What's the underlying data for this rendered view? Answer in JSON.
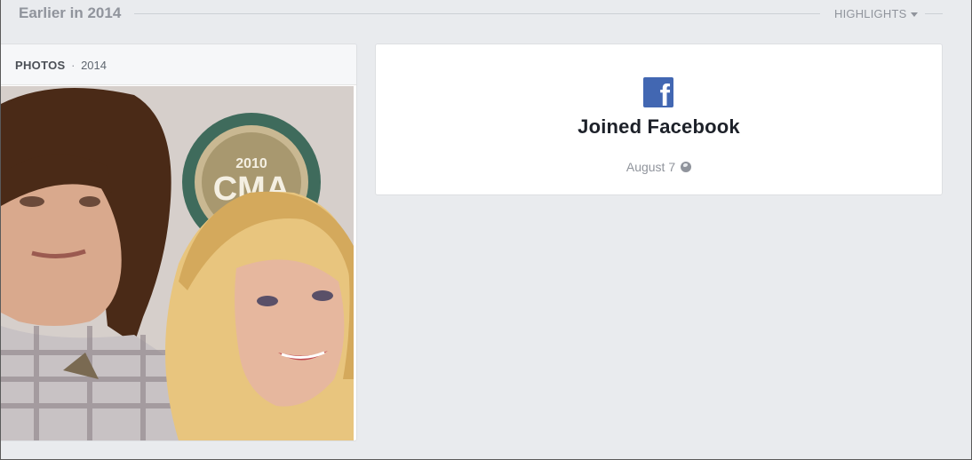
{
  "section": {
    "title": "Earlier in 2014",
    "highlights_label": "HIGHLIGHTS"
  },
  "photos": {
    "label": "PHOTOS",
    "separator": "·",
    "year": "2014"
  },
  "joined": {
    "title": "Joined Facebook",
    "date": "August 7",
    "logo_glyph": "f",
    "brand_color": "#4267b2"
  },
  "colors": {
    "page_background": "#e9ebee",
    "muted_text": "#90949c"
  },
  "icons": [
    "facebook-logo-icon",
    "globe-icon",
    "caret-down-icon"
  ]
}
